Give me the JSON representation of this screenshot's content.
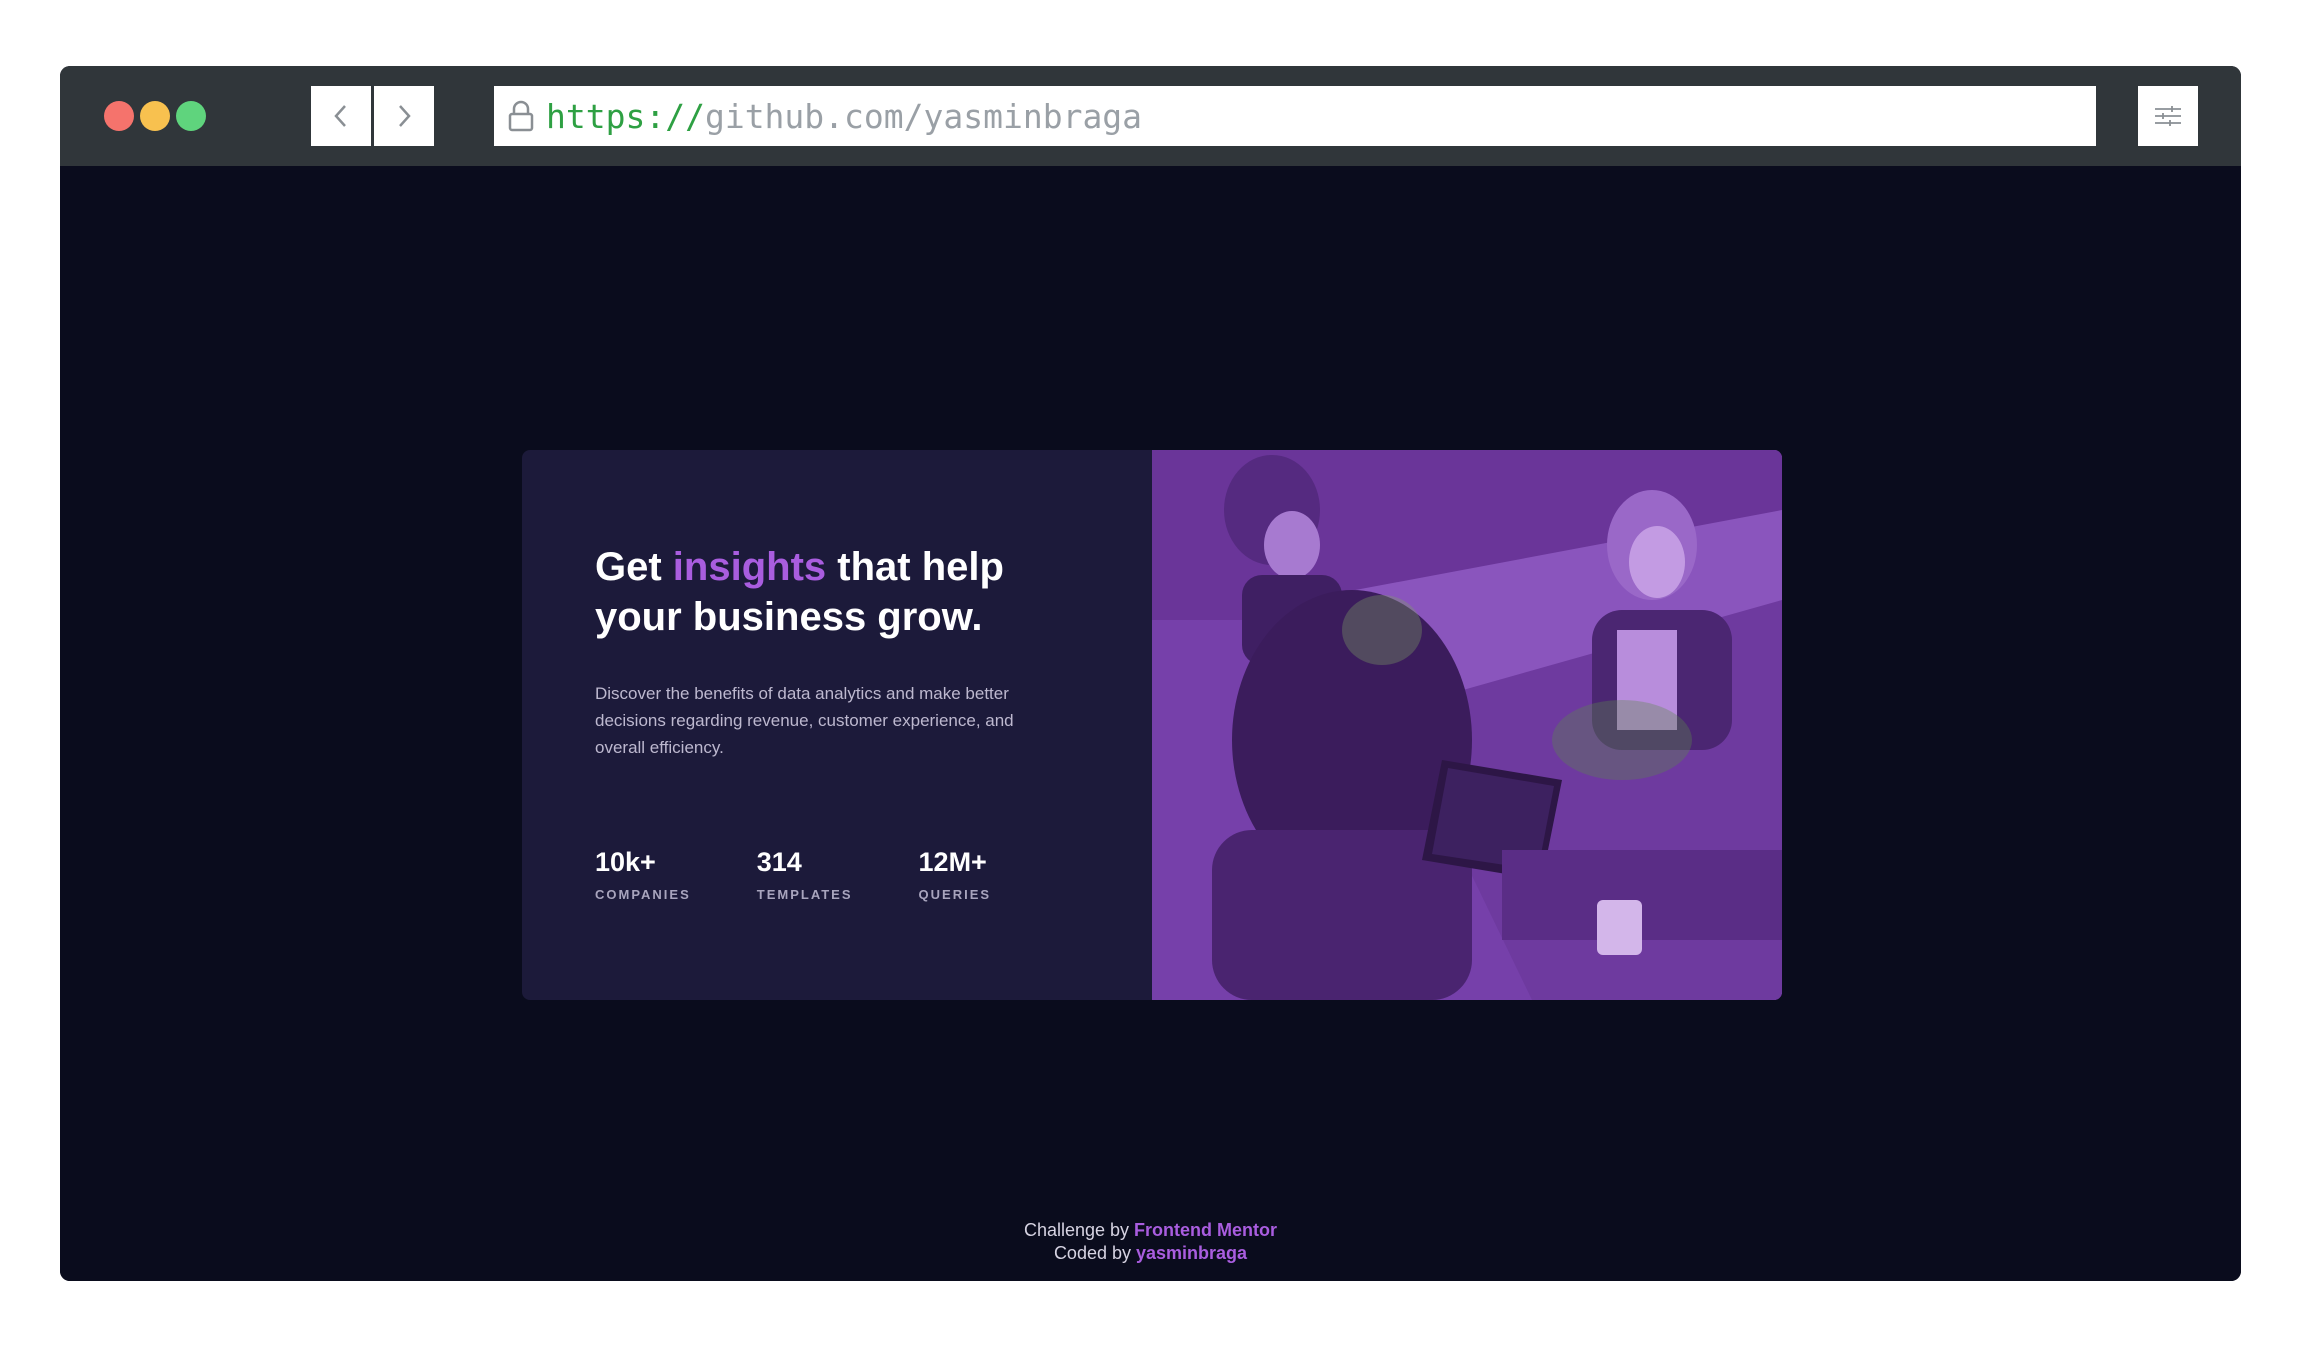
{
  "browser": {
    "url_scheme": "https://",
    "url_host": "github.com/yasminbraga",
    "icons": {
      "back": "chevron-left-icon",
      "forward": "chevron-right-icon",
      "lock": "lock-icon",
      "menu": "sliders-icon"
    }
  },
  "card": {
    "headline_prefix": "Get ",
    "headline_accent": "insights",
    "headline_suffix": " that help your business grow.",
    "description": "Discover the benefits of data analytics and make better decisions regarding revenue, customer experience, and overall efficiency.",
    "stats": [
      {
        "value": "10k+",
        "label": "COMPANIES"
      },
      {
        "value": "314",
        "label": "TEMPLATES"
      },
      {
        "value": "12M+",
        "label": "QUERIES"
      }
    ],
    "accent_color": "#a95ddf"
  },
  "footer": {
    "challenge_text": "Challenge by ",
    "challenge_link": "Frontend Mentor",
    "coded_text": "Coded by ",
    "coded_link": "yasminbraga"
  }
}
